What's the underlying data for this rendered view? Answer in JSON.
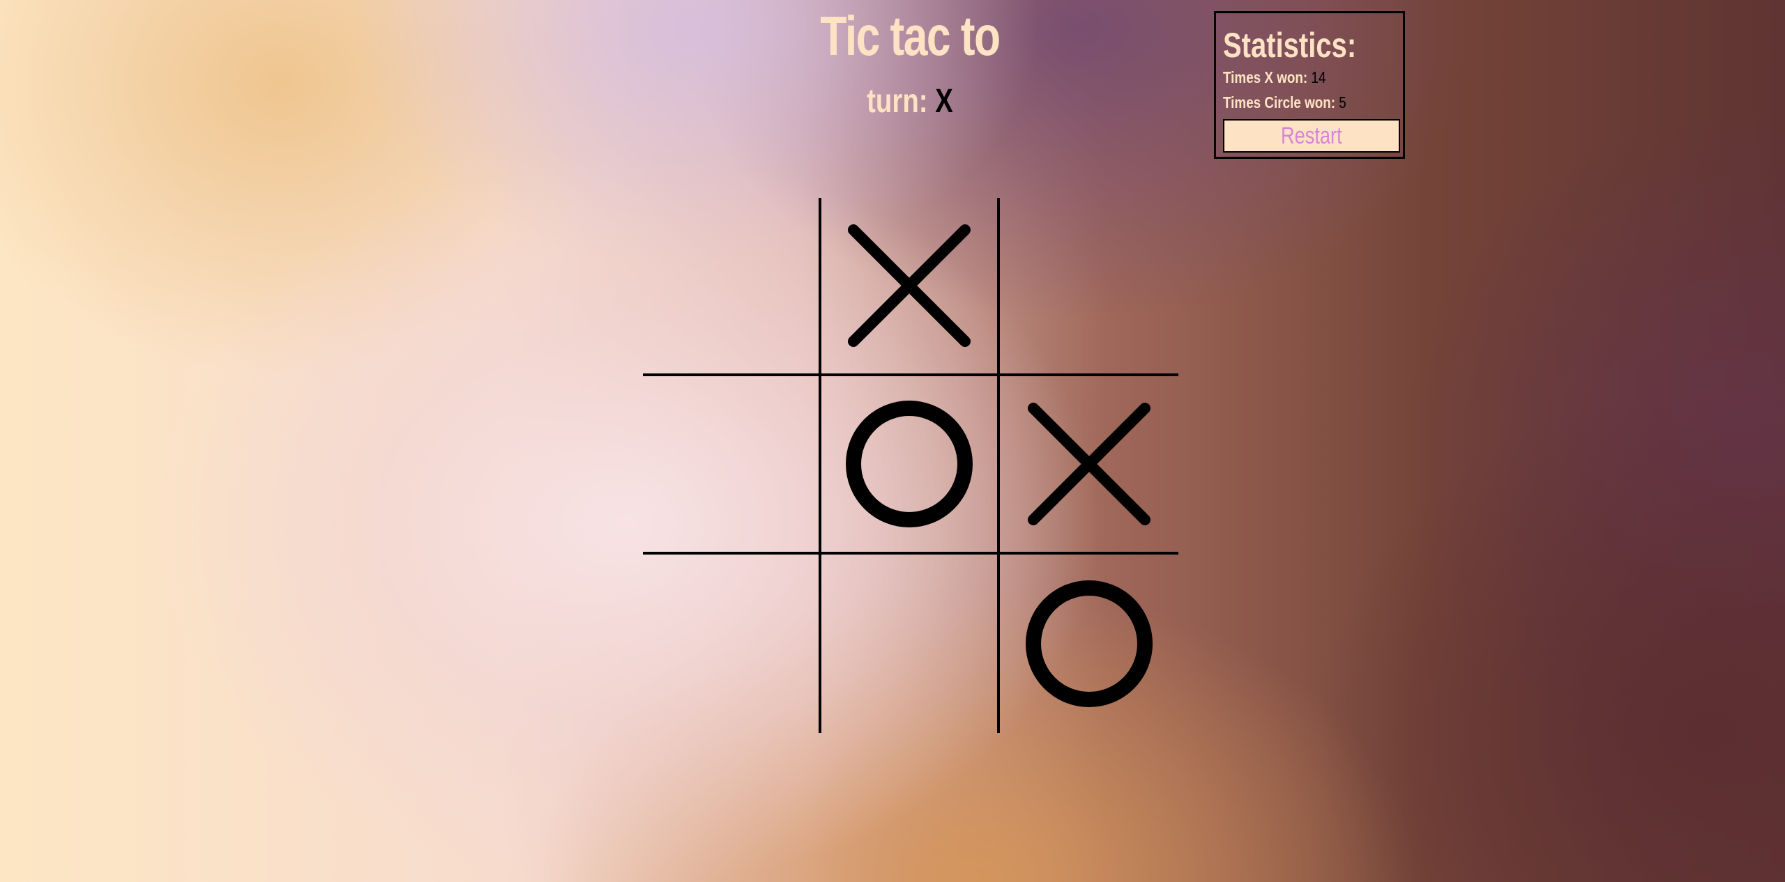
{
  "header": {
    "title": "Tic tac to",
    "turn_label": "turn:",
    "turn_value": "X"
  },
  "stats": {
    "title": "Statistics:",
    "x_won_label": "Times X won:",
    "x_won_value": "14",
    "circle_won_label": "Times Circle won:",
    "circle_won_value": "5",
    "restart_label": "Restart"
  },
  "board": {
    "cells": [
      "",
      "X",
      "",
      "",
      "O",
      "X",
      "",
      "",
      "O"
    ]
  },
  "colors": {
    "text_accent": "#fde3c4",
    "restart_text": "#d884d6",
    "marks": "#000000"
  }
}
